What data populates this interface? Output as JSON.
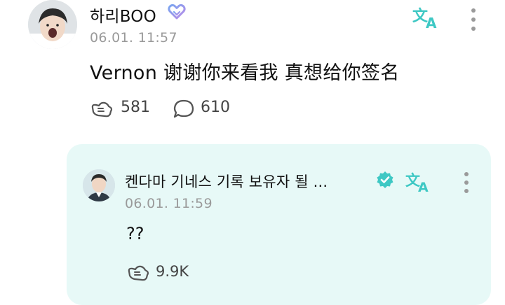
{
  "post": {
    "author": "하리BOO",
    "timestamp": "06.01. 11:57",
    "text": "Vernon 谢谢你来看我 真想给你签名",
    "like_count": "581",
    "comment_count": "610",
    "icons": {
      "badge": "heart-badge-icon",
      "translate": "translate-icon",
      "more": "more-vertical-icon",
      "like": "like-hand-icon",
      "comment": "comment-bubble-icon"
    }
  },
  "reply": {
    "author": "켄다마 기네스 기록 보유자 될 ...",
    "timestamp": "06.01. 11:59",
    "text": "??",
    "like_count": "9.9K",
    "icons": {
      "verified": "verified-check-icon",
      "translate": "translate-icon",
      "more": "more-vertical-icon",
      "like": "like-hand-icon"
    }
  },
  "colors": {
    "accent_teal": "#3ec8c4",
    "reply_bg": "#e7f9f7",
    "heart_gradient": [
      "#7aa6f0",
      "#b98be8"
    ],
    "muted_text": "#9a9a9a"
  }
}
